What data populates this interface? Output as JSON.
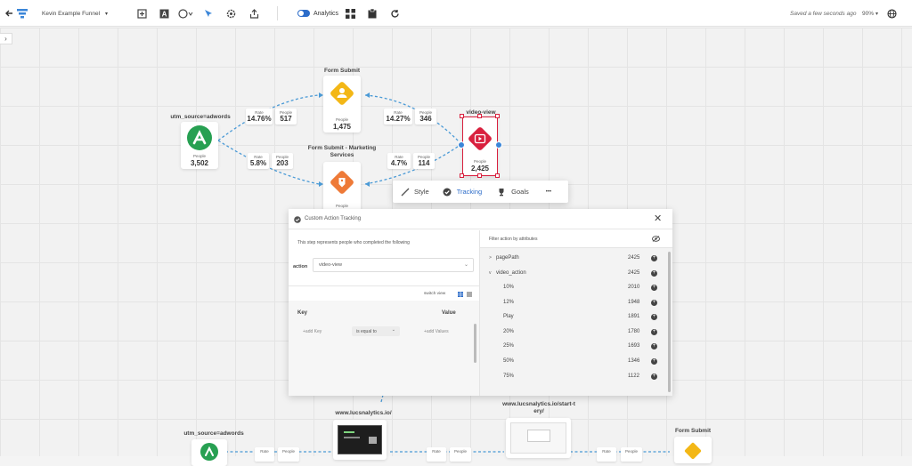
{
  "topbar": {
    "funnel_name": "Kevin Example Funnel",
    "analytics_label": "Analytics",
    "saved_status": "Saved a few seconds ago",
    "zoom": "90%"
  },
  "nodes": {
    "utm": {
      "title": "utm_source=adwords",
      "people_label": "People",
      "people": "3,502"
    },
    "form_submit": {
      "title": "Form Submit",
      "people_label": "People",
      "people": "1,475"
    },
    "form_submit_marketing": {
      "title": "Form Submit - Marketing Services",
      "people_label": "People"
    },
    "video_view": {
      "title": "video-view",
      "people_label": "People",
      "people": "2,425"
    }
  },
  "stats": [
    {
      "rate_label": "Rate",
      "rate": "14.76%",
      "people_label": "People",
      "people": "517"
    },
    {
      "rate_label": "Rate",
      "rate": "5.8%",
      "people_label": "People",
      "people": "203"
    },
    {
      "rate_label": "Rate",
      "rate": "14.27%",
      "people_label": "People",
      "people": "346"
    },
    {
      "rate_label": "Rate",
      "rate": "4.7%",
      "people_label": "People",
      "people": "114"
    }
  ],
  "toolbar_popup": {
    "style": "Style",
    "tracking": "Tracking",
    "goals": "Goals",
    "more": "•••"
  },
  "panel": {
    "title": "Custom Action Tracking",
    "close": "✕",
    "description": "This step represents people who completed the following",
    "action_label": "action",
    "action_value": "video-view",
    "switch_view": "switch view",
    "key_header": "Key",
    "value_header": "Value",
    "add_key": "+add Key",
    "operator": "is equal to",
    "add_values": "+add Values",
    "filter_header": "Filter action by attributes",
    "attributes": [
      {
        "label": "pagePath",
        "count": "2425",
        "caret": ">"
      },
      {
        "label": "video_action",
        "count": "2425",
        "caret": "v"
      }
    ],
    "values": [
      {
        "label": "10%",
        "count": "2010"
      },
      {
        "label": "12%",
        "count": "1948"
      },
      {
        "label": "Play",
        "count": "1891"
      },
      {
        "label": "20%",
        "count": "1780"
      },
      {
        "label": "25%",
        "count": "1693"
      },
      {
        "label": "50%",
        "count": "1346"
      },
      {
        "label": "75%",
        "count": "1122"
      }
    ]
  },
  "bottom": {
    "utm_title": "utm_source=adwords",
    "site1": "www.lucsnalytics.io/",
    "site2": "www.lucsnalytics.io/start-t\nery/",
    "form_submit": "Form Submit",
    "rate": "Rate",
    "people": "People"
  },
  "colors": {
    "green": "#27a052",
    "yellow": "#f3b716",
    "orange": "#ee7a38",
    "red": "#d9203e",
    "blue": "#3b86d8"
  }
}
